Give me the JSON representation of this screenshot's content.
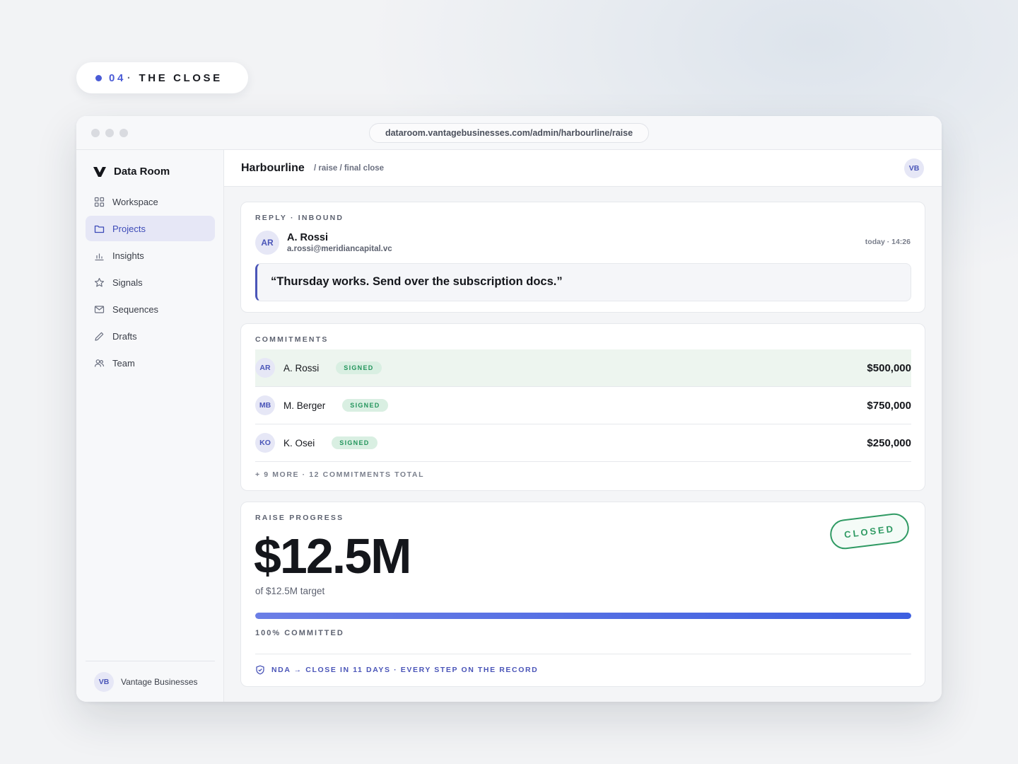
{
  "step": {
    "number": "04",
    "separator": "·",
    "title": "THE CLOSE"
  },
  "browser": {
    "url": "dataroom.vantagebusinesses.com/admin/harbourline/raise"
  },
  "sidebar": {
    "brand": "Data Room",
    "items": [
      {
        "label": "Workspace",
        "icon": "grid-icon"
      },
      {
        "label": "Projects",
        "icon": "folder-icon",
        "active": true
      },
      {
        "label": "Insights",
        "icon": "bar-chart-icon"
      },
      {
        "label": "Signals",
        "icon": "star-icon"
      },
      {
        "label": "Sequences",
        "icon": "mail-icon"
      },
      {
        "label": "Drafts",
        "icon": "pencil-icon"
      },
      {
        "label": "Team",
        "icon": "users-icon"
      }
    ],
    "footer": {
      "initials": "VB",
      "name": "Vantage Businesses"
    }
  },
  "header": {
    "title": "Harbourline",
    "breadcrumb": "/ raise / final close",
    "user_initials": "VB"
  },
  "reply": {
    "label": "REPLY · INBOUND",
    "initials": "AR",
    "name": "A. Rossi",
    "email": "a.rossi@meridiancapital.vc",
    "time": "today · 14:26",
    "quote": "“Thursday works. Send over the subscription docs.”"
  },
  "commitments": {
    "label": "COMMITMENTS",
    "rows": [
      {
        "initials": "AR",
        "name": "A. Rossi",
        "status": "SIGNED",
        "amount": "$500,000"
      },
      {
        "initials": "MB",
        "name": "M. Berger",
        "status": "SIGNED",
        "amount": "$750,000"
      },
      {
        "initials": "KO",
        "name": "K. Osei",
        "status": "SIGNED",
        "amount": "$250,000"
      }
    ],
    "more": "+ 9 MORE · 12 COMMITMENTS TOTAL"
  },
  "raise": {
    "label": "RAISE PROGRESS",
    "amount": "$12.5M",
    "target": "of $12.5M target",
    "stamp": "CLOSED",
    "progress_percent": 100,
    "progress_label": "100% COMMITTED",
    "footer": "NDA → CLOSE IN 11 DAYS · EVERY STEP ON THE RECORD"
  },
  "colors": {
    "accent": "#4a55b8",
    "signed": "#23955c",
    "progress_start": "#6b7ee6",
    "progress_end": "#3d5fe0"
  }
}
